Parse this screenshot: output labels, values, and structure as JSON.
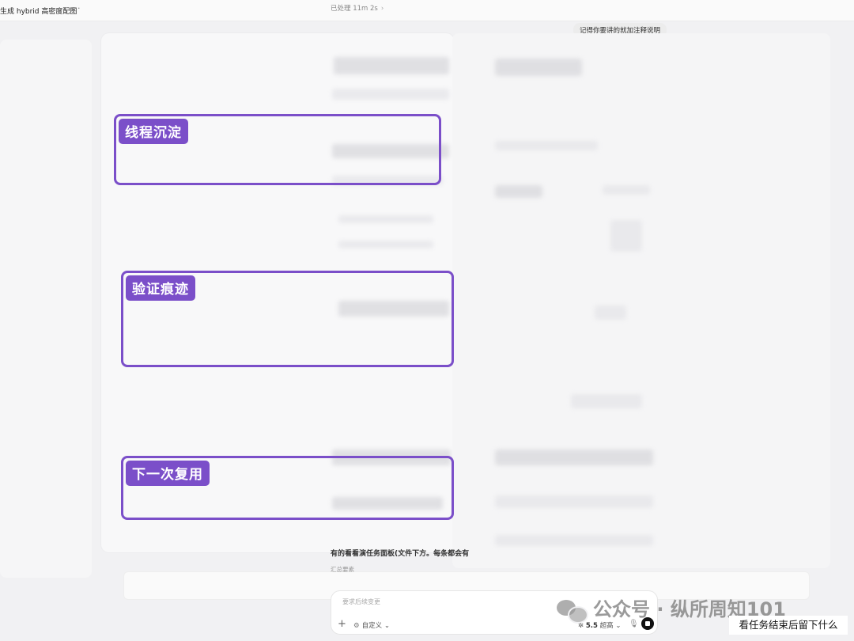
{
  "header": {
    "title": "生成 hybrid 高密度配图",
    "more_label": "···",
    "processed_label": "已处理 11m 2s",
    "processed_chevron": "›"
  },
  "conversation": {
    "user_message": "记得你要讲的就加注释说明",
    "visible_fragment": "有的看看演任务面板(文件下方。每条都会有",
    "summary_label": "汇总要素"
  },
  "annotations": [
    {
      "label": "线程沉淀"
    },
    {
      "label": "验证痕迹"
    },
    {
      "label": "下一次复用"
    }
  ],
  "composer": {
    "placeholder": "要求后续变更",
    "plus": "+",
    "custom_label": "自定义",
    "custom_chevron": "⌄",
    "model_version": "5.5",
    "model_mode": "超高",
    "model_chevron": "⌄",
    "mic_icon": "mic-icon",
    "stop_icon": "stop-icon"
  },
  "watermark": {
    "text": "公众号 · 纵所周知101"
  },
  "caption": {
    "text": "看任务结束后留下什么"
  },
  "colors": {
    "annotation": "#7b4fc9",
    "background": "#f1f1f3"
  }
}
